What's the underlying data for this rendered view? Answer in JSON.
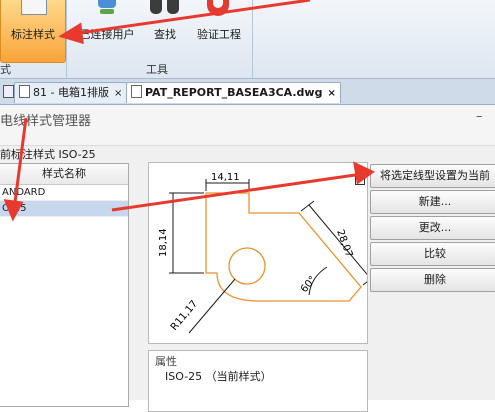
{
  "ribbon": {
    "buttons": [
      {
        "label": "标注样式"
      },
      {
        "label": "已连接用户"
      },
      {
        "label": "查找"
      },
      {
        "label": "验证工程"
      }
    ],
    "left_group_label": "式",
    "group_label": "工具"
  },
  "tabs": [
    {
      "label": "81 - 电箱1排版"
    },
    {
      "label": "PAT_REPORT_BASEA3CA.dwg"
    }
  ],
  "tab_close": "×",
  "dialog": {
    "title": "电线样式管理器",
    "minimize": "–",
    "current_style_label": "前标注样式 ISO-25",
    "list_header": "样式名称",
    "list_items": [
      "ANDARD",
      "O-25"
    ],
    "buttons": [
      "将选定线型设置为当前",
      "新建...",
      "更改...",
      "比较",
      "删除"
    ],
    "props_title": "属性",
    "props_value": "ISO-25 （当前样式）"
  },
  "preview": {
    "dim_top": "14,11",
    "dim_left": "18,14",
    "dim_diag": "28,07",
    "angle": "60°",
    "radius": "R11,17"
  },
  "colors": {
    "accent": "#e8392f",
    "highlight": "#f8a43a",
    "drawing": "#e8932f"
  }
}
